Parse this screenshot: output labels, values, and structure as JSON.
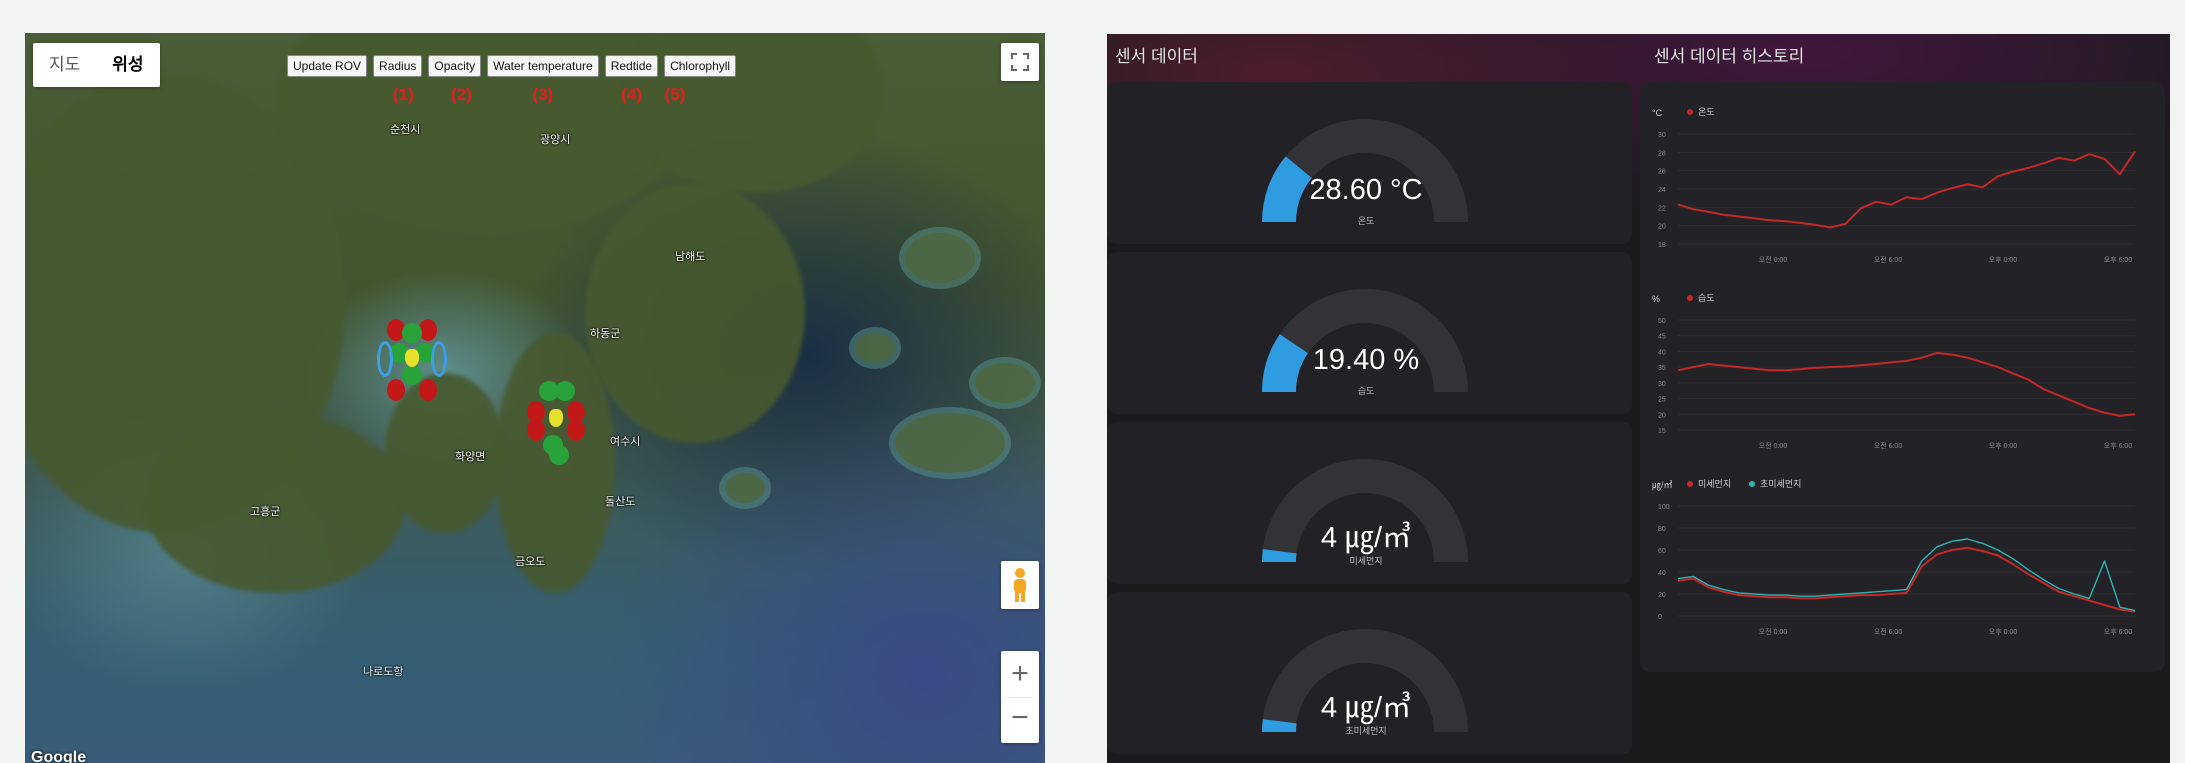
{
  "map": {
    "maptype": {
      "map_label": "지도",
      "satellite_label": "위성"
    },
    "toolbar": [
      {
        "label": "Update ROV",
        "num": "(1)"
      },
      {
        "label": "Radius",
        "num": "(2)"
      },
      {
        "label": "Opacity",
        "num": "(3)"
      },
      {
        "label": "Water temperature",
        "num": "(4)"
      },
      {
        "label": "Redtide",
        "num": "(5)"
      },
      {
        "label": "Chlorophyll",
        "num": ""
      }
    ],
    "zoom_in": "+",
    "zoom_out": "−",
    "attribution": "Google",
    "places": [
      "순천시",
      "광양시",
      "남해도",
      "여수시",
      "하동군",
      "돌산도",
      "금오도",
      "나로도항",
      "화양면",
      "고흥군"
    ]
  },
  "dashboard": {
    "sensor_title": "센서 데이터",
    "history_title": "센서 데이터 히스토리",
    "gauges": [
      {
        "value": "28.60 °C",
        "label": "온도",
        "fraction": 0.22
      },
      {
        "value": "19.40 %",
        "label": "습도",
        "fraction": 0.19
      },
      {
        "value": "4 ㎍/㎥",
        "label": "미세먼지",
        "fraction": 0.04
      },
      {
        "value": "4 ㎍/㎥",
        "label": "초미세먼지",
        "fraction": 0.04
      }
    ],
    "colors": {
      "gauge_fill": "#2f9be0",
      "gauge_track": "#333337",
      "line_red": "#c62828",
      "line_teal": "#29b6b6"
    }
  },
  "chart_data": [
    {
      "type": "line",
      "ylabel": "°C",
      "ylim": [
        18,
        30
      ],
      "yticks": [
        "30",
        "28",
        "26",
        "24",
        "22",
        "20",
        "18"
      ],
      "xticks": [
        "오전 0:00",
        "오전 6:00",
        "오후 0:00",
        "오후 6:00"
      ],
      "series": [
        {
          "name": "온도",
          "values": [
            22.3,
            21.8,
            21.5,
            21.2,
            21.0,
            20.8,
            20.6,
            20.5,
            20.3,
            20.1,
            19.8,
            20.2,
            21.9,
            22.6,
            22.3,
            23.1,
            22.9,
            23.6,
            24.1,
            24.5,
            24.2,
            25.4,
            25.9,
            26.3,
            26.8,
            27.4,
            27.1,
            27.8,
            27.3,
            25.6,
            28.1
          ]
        }
      ]
    },
    {
      "type": "line",
      "ylabel": "%",
      "ylim": [
        15,
        50
      ],
      "yticks": [
        "50",
        "45",
        "40",
        "35",
        "30",
        "25",
        "20",
        "15"
      ],
      "xticks": [
        "오전 0:00",
        "오전 6:00",
        "오후 0:00",
        "오후 6:00"
      ],
      "series": [
        {
          "name": "습도",
          "values": [
            34,
            35,
            36,
            35.5,
            35,
            34.5,
            34,
            34,
            34.3,
            34.8,
            35,
            35.2,
            35.6,
            36,
            36.5,
            37,
            38,
            39.5,
            39,
            38,
            36.5,
            35,
            33,
            31,
            28,
            26,
            24,
            22,
            20.5,
            19.5,
            20
          ]
        }
      ]
    },
    {
      "type": "line",
      "ylabel": "㎍/㎥",
      "ylim": [
        0,
        100
      ],
      "yticks": [
        "100",
        "80",
        "60",
        "40",
        "20",
        "0"
      ],
      "xticks": [
        "오전 0:00",
        "오전 6:00",
        "오후 0:00",
        "오후 6:00"
      ],
      "series": [
        {
          "name": "미세먼지",
          "values": [
            32,
            34,
            26,
            22,
            19,
            18,
            17,
            17,
            16,
            16,
            17,
            18,
            19,
            19,
            20,
            21,
            45,
            56,
            60,
            62,
            59,
            55,
            47,
            38,
            30,
            22,
            18,
            14,
            10,
            6,
            4
          ]
        },
        {
          "name": "초미세먼지",
          "values": [
            34,
            36,
            28,
            24,
            21,
            20,
            19,
            19,
            18,
            18,
            19,
            20,
            21,
            22,
            23,
            24,
            50,
            63,
            68,
            70,
            66,
            60,
            52,
            42,
            33,
            25,
            20,
            16,
            50,
            8,
            5
          ]
        }
      ]
    }
  ]
}
